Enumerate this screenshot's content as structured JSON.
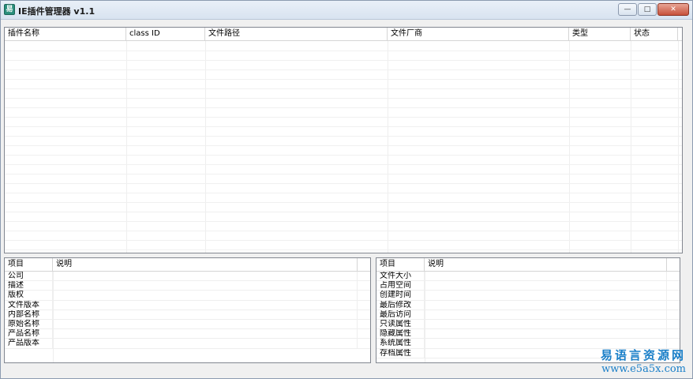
{
  "window": {
    "title": "IE插件管理器 v1.1",
    "icon": "app-icon",
    "buttons": {
      "minimize": "—",
      "maximize": "□",
      "close": "✕"
    }
  },
  "plugins": {
    "columns": [
      "插件名称",
      "class ID",
      "文件路径",
      "文件厂商",
      "类型",
      "状态"
    ],
    "rows": []
  },
  "details_left": {
    "columns": [
      "项目",
      "说明"
    ],
    "items": [
      "公司",
      "描述",
      "版权",
      "文件版本",
      "内部名称",
      "原始名称",
      "产品名称",
      "产品版本"
    ]
  },
  "details_right": {
    "columns": [
      "项目",
      "说明"
    ],
    "items": [
      "文件大小",
      "占用空间",
      "创建时间",
      "最后修改",
      "最后访问",
      "只读属性",
      "隐藏属性",
      "系统属性",
      "存档属性"
    ]
  },
  "watermark": {
    "line1": "易语言资源网",
    "line2": "www.e5a5x.com"
  }
}
